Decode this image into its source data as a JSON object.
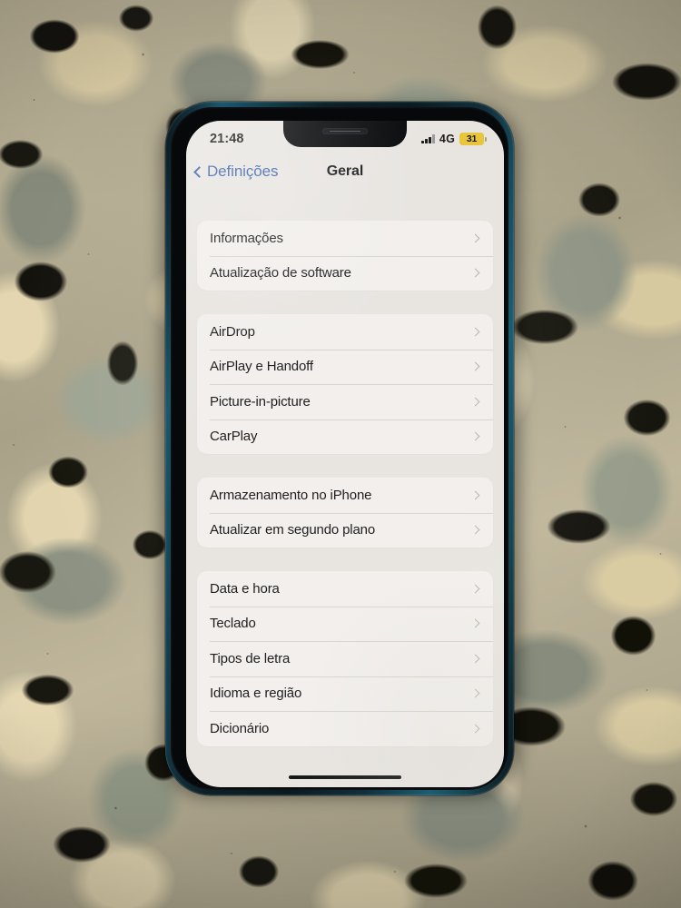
{
  "scene": {
    "description": "photo-of-iphone-on-granite-countertop",
    "surface": "granite-countertop",
    "device": "iphone-pacific-blue"
  },
  "status_bar": {
    "time": "21:48",
    "signal_icon": "cellular-signal-bars-icon",
    "signal_bars_filled": 3,
    "signal_bars_total": 4,
    "network": "4G",
    "battery_percent": "31",
    "battery_icon": "battery-low-power-mode-icon",
    "battery_color": "#e8c53a"
  },
  "nav_bar": {
    "back_icon": "chevron-left-icon",
    "back_label": "Definições",
    "title": "Geral",
    "accent_color": "#3f63ad"
  },
  "settings": {
    "chevron_icon": "chevron-right-icon",
    "groups": [
      {
        "id": "group-info",
        "rows": [
          {
            "label": "Informações"
          },
          {
            "label": "Atualização de software"
          }
        ]
      },
      {
        "id": "group-connectivity",
        "rows": [
          {
            "label": "AirDrop"
          },
          {
            "label": "AirPlay e Handoff"
          },
          {
            "label": "Picture-in-picture"
          },
          {
            "label": "CarPlay"
          }
        ]
      },
      {
        "id": "group-storage",
        "rows": [
          {
            "label": "Armazenamento no iPhone"
          },
          {
            "label": "Atualizar em segundo plano"
          }
        ]
      },
      {
        "id": "group-locale",
        "rows": [
          {
            "label": "Data e hora"
          },
          {
            "label": "Teclado"
          },
          {
            "label": "Tipos de letra"
          },
          {
            "label": "Idioma e região"
          },
          {
            "label": "Dicionário"
          }
        ]
      }
    ]
  },
  "home_indicator": {
    "name": "home-indicator-bar"
  }
}
